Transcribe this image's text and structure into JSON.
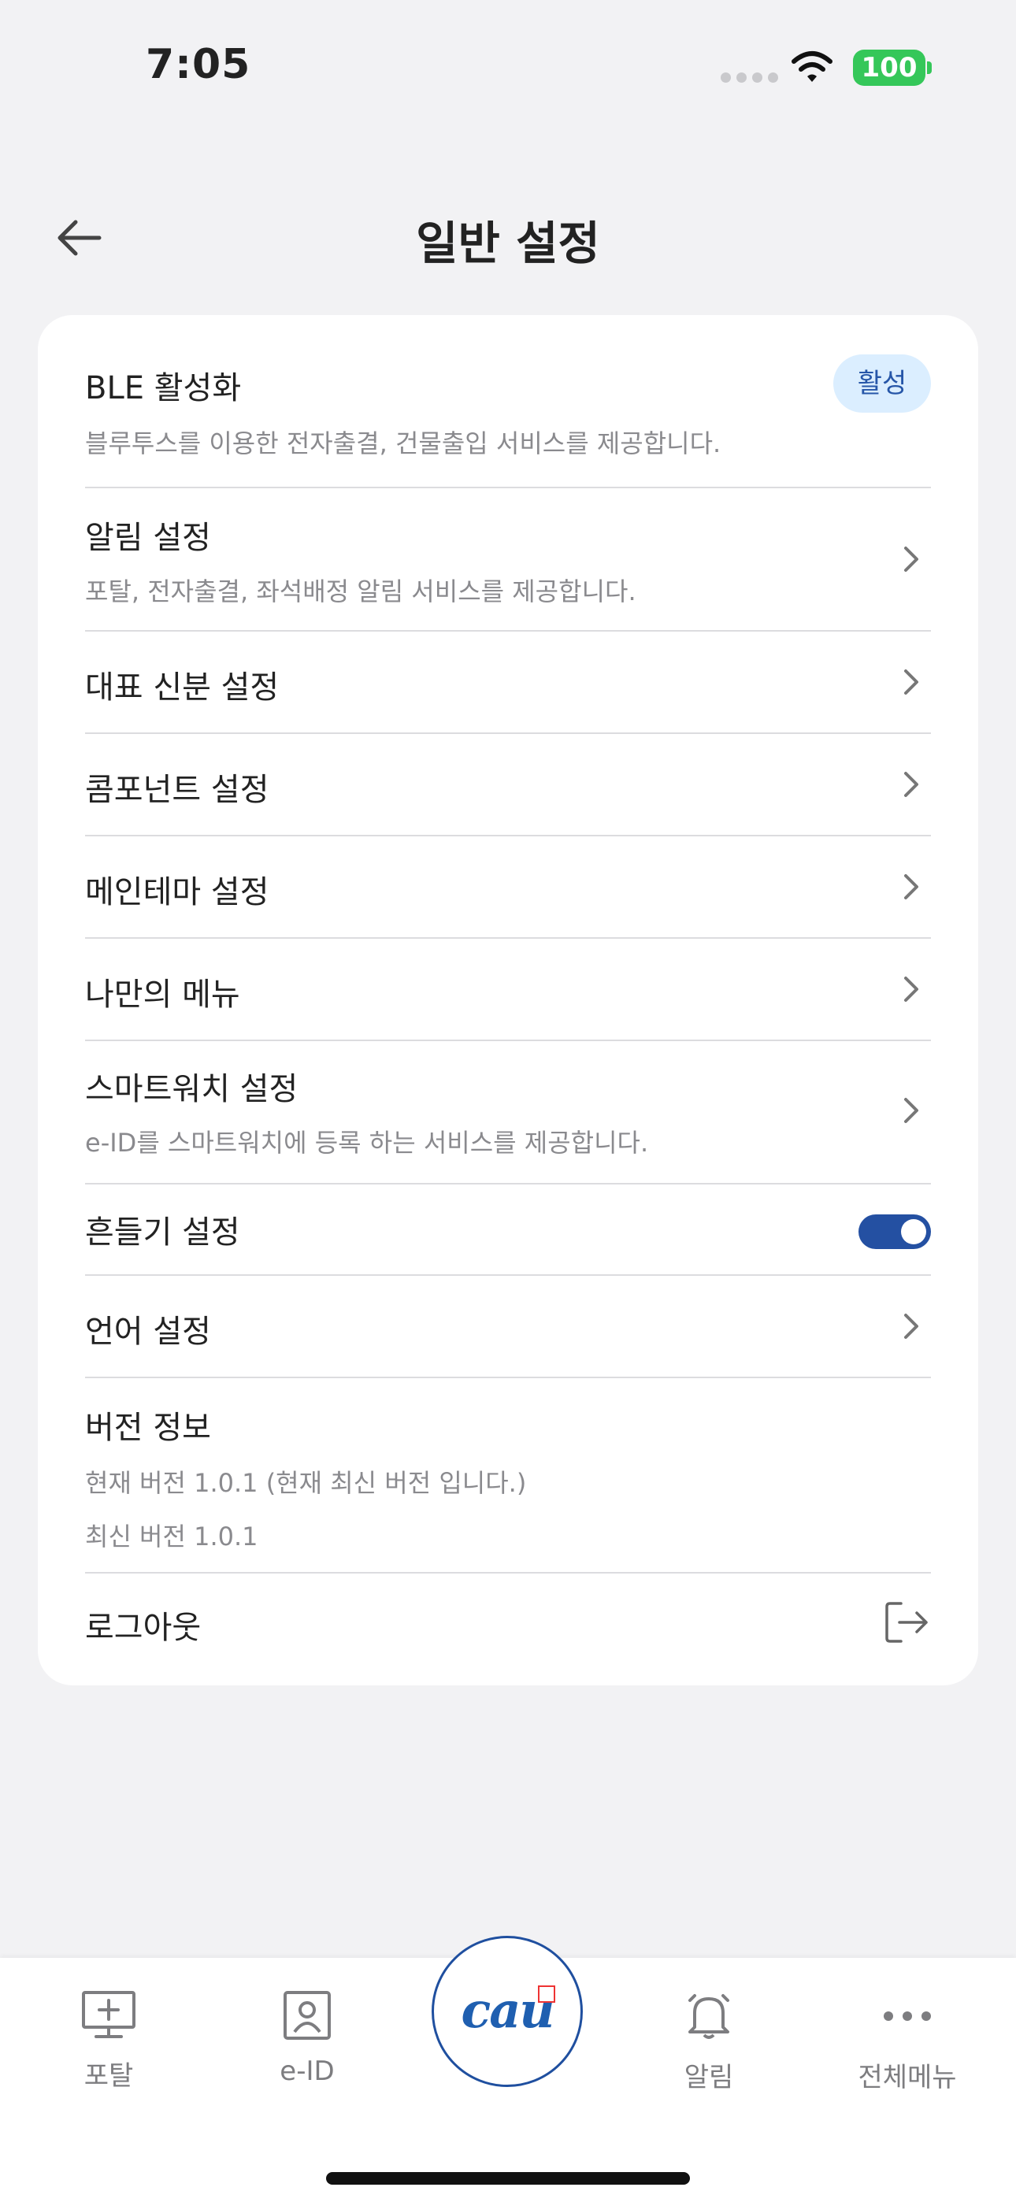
{
  "status_bar": {
    "time": "7:05",
    "battery": "100"
  },
  "header": {
    "title": "일반 설정",
    "back_icon": "arrow-left-icon"
  },
  "settings": {
    "ble": {
      "title": "BLE 활성화",
      "desc": "블루투스를 이용한 전자출결, 건물출입 서비스를 제공합니다.",
      "badge": "활성"
    },
    "notification": {
      "title": "알림 설정",
      "desc": "포탈, 전자출결, 좌석배정 알림 서비스를 제공합니다."
    },
    "identity": {
      "title": "대표 신분 설정"
    },
    "component": {
      "title": "콤포넌트 설정"
    },
    "theme": {
      "title": "메인테마 설정"
    },
    "my_menu": {
      "title": "나만의 메뉴"
    },
    "smartwatch": {
      "title": "스마트워치 설정",
      "desc": "e-ID를 스마트워치에 등록 하는 서비스를 제공합니다."
    },
    "shake": {
      "title": "흔들기 설정",
      "enabled": true
    },
    "language": {
      "title": "언어 설정"
    },
    "version": {
      "title": "버전 정보",
      "current": "현재 버전 1.0.1 (현재 최신 버전 입니다.)",
      "latest": "최신 버전 1.0.1"
    },
    "logout": {
      "title": "로그아웃"
    }
  },
  "tabbar": {
    "portal": "포탈",
    "eid": "e-ID",
    "center_logo": "cau",
    "alarm": "알림",
    "all_menu": "전체메뉴"
  },
  "colors": {
    "accent": "#2450a2",
    "badge_bg": "#dbeeff",
    "battery": "#35c759"
  }
}
